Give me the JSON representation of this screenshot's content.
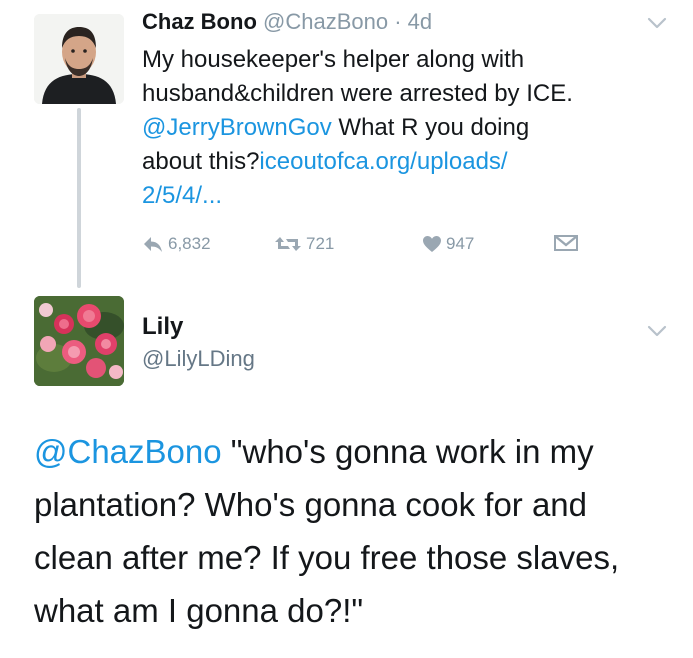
{
  "tweet1": {
    "name": "Chaz Bono",
    "handle": "@ChazBono",
    "separator": " · ",
    "time": "4d",
    "text_line1": "My housekeeper's helper along with",
    "text_line2": "husband&children were arrested by ICE.",
    "mention": "@JerryBrownGov",
    "text_after_mention": " What R you doing",
    "text_about": "about this?",
    "link_part1": "iceoutofca.org/uploads/",
    "link_part2": "2/5/4/...",
    "replies": "6,832",
    "retweets": "721",
    "likes": "947",
    "avatar_icon": "person-photo"
  },
  "tweet2": {
    "name": "Lily",
    "handle": "@LilyLDing",
    "mention": "@ChazBono",
    "text": " \"who's gonna work in my plantation? Who's gonna cook for and clean after me? If you free those slaves, what am I gonna do?!\"",
    "avatar_icon": "flowers-photo"
  },
  "colors": {
    "link": "#1b95e0",
    "muted": "#8899a6",
    "text": "#14171a",
    "thread_line": "#cfd5da"
  }
}
